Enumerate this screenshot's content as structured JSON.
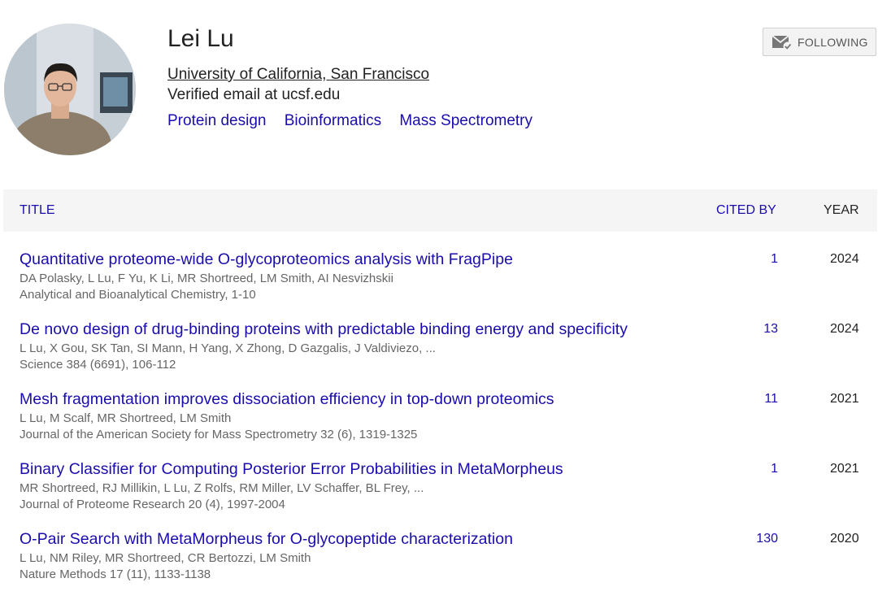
{
  "profile": {
    "name": "Lei Lu",
    "affiliation": "University of California, San Francisco",
    "email": "Verified email at ucsf.edu",
    "interests": [
      "Protein design",
      "Bioinformatics",
      "Mass Spectrometry"
    ]
  },
  "follow_button": {
    "label": "FOLLOWING",
    "icon": "mail-check-icon"
  },
  "table": {
    "headers": {
      "title": "TITLE",
      "cited_by": "CITED BY",
      "year": "YEAR"
    },
    "rows": [
      {
        "title": "Quantitative proteome-wide O-glycoproteomics analysis with FragPipe",
        "authors": "DA Polasky, L Lu, F Yu, K Li, MR Shortreed, LM Smith, AI Nesvizhskii",
        "venue": "Analytical and Bioanalytical Chemistry, 1-10",
        "cited_by": "1",
        "year": "2024"
      },
      {
        "title": "De novo design of drug-binding proteins with predictable binding energy and specificity",
        "authors": "L Lu, X Gou, SK Tan, SI Mann, H Yang, X Zhong, D Gazgalis, J Valdiviezo, ...",
        "venue": "Science 384 (6691), 106-112",
        "cited_by": "13",
        "year": "2024"
      },
      {
        "title": "Mesh fragmentation improves dissociation efficiency in top-down proteomics",
        "authors": "L Lu, M Scalf, MR Shortreed, LM Smith",
        "venue": "Journal of the American Society for Mass Spectrometry 32 (6), 1319-1325",
        "cited_by": "11",
        "year": "2021"
      },
      {
        "title": "Binary Classifier for Computing Posterior Error Probabilities in MetaMorpheus",
        "authors": "MR Shortreed, RJ Millikin, L Lu, Z Rolfs, RM Miller, LV Schaffer, BL Frey, ...",
        "venue": "Journal of Proteome Research 20 (4), 1997-2004",
        "cited_by": "1",
        "year": "2021"
      },
      {
        "title": "O-Pair Search with MetaMorpheus for O-glycopeptide characterization",
        "authors": "L Lu, NM Riley, MR Shortreed, CR Bertozzi, LM Smith",
        "venue": "Nature Methods 17 (11), 1133-1138",
        "cited_by": "130",
        "year": "2020"
      }
    ]
  },
  "colors": {
    "link": "#1a0dab",
    "header_bg": "#f5f5f5",
    "meta_text": "#666666"
  }
}
